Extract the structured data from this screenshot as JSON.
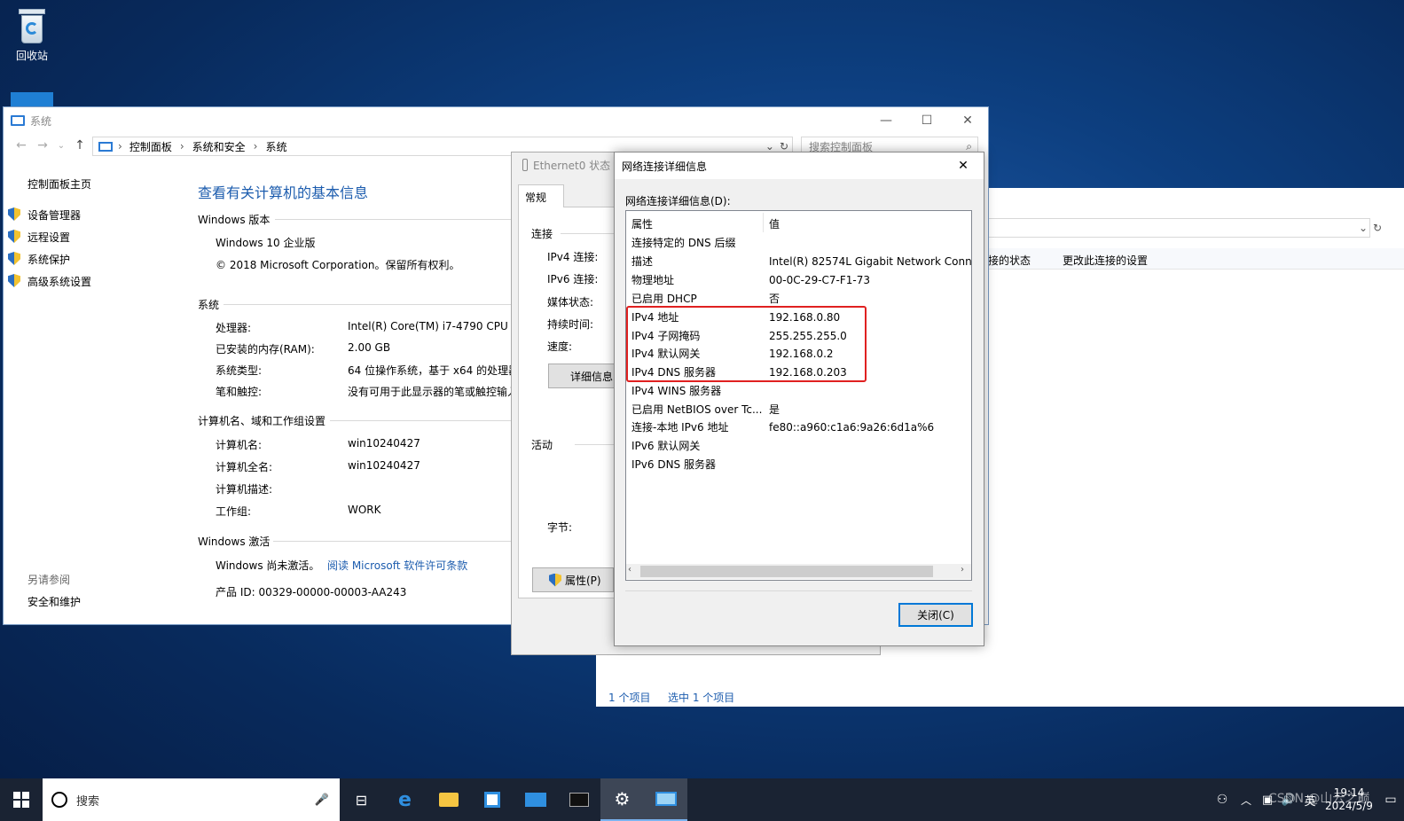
{
  "desktop": {
    "recycle_bin_label": "回收站"
  },
  "system_window": {
    "title": "系统",
    "breadcrumb": [
      "控制面板",
      "系统和安全",
      "系统"
    ],
    "search_placeholder": "搜索控制面板",
    "sidebar": {
      "home": "控制面板主页",
      "items": [
        "设备管理器",
        "远程设置",
        "系统保护",
        "高级系统设置"
      ],
      "see_also_title": "另请参阅",
      "see_also_items": [
        "安全和维护"
      ]
    },
    "heading": "查看有关计算机的基本信息",
    "windows_edition": {
      "title": "Windows 版本",
      "edition": "Windows 10 企业版",
      "copyright": "© 2018 Microsoft Corporation。保留所有权利。"
    },
    "system": {
      "title": "系统",
      "rows": [
        {
          "label": "处理器:",
          "value": "Intel(R) Core(TM) i7-4790 CPU @"
        },
        {
          "label": "已安装的内存(RAM):",
          "value": "2.00 GB"
        },
        {
          "label": "系统类型:",
          "value": "64 位操作系统，基于 x64 的处理器"
        },
        {
          "label": "笔和触控:",
          "value": "没有可用于此显示器的笔或触控输入"
        }
      ]
    },
    "computer_name": {
      "title": "计算机名、域和工作组设置",
      "rows": [
        {
          "label": "计算机名:",
          "value": "win10240427"
        },
        {
          "label": "计算机全名:",
          "value": "win10240427"
        },
        {
          "label": "计算机描述:",
          "value": ""
        },
        {
          "label": "工作组:",
          "value": "WORK"
        }
      ]
    },
    "activation": {
      "title": "Windows 激活",
      "status": "Windows 尚未激活。",
      "link": "阅读 Microsoft 软件许可条款",
      "product_id": "产品 ID: 00329-00000-00003-AA243"
    }
  },
  "ethernet_window": {
    "title": "Ethernet0 状态",
    "tab": "常规",
    "connection_title": "连接",
    "fields": [
      "IPv4 连接:",
      "IPv6 连接:",
      "媒体状态:",
      "持续时间:",
      "速度:"
    ],
    "details_button": "详细信息",
    "activity_title": "活动",
    "bytes_label": "字节:",
    "properties_button": "属性(P)"
  },
  "details_dialog": {
    "title": "网络连接详细信息",
    "list_label": "网络连接详细信息(D):",
    "col_property": "属性",
    "col_value": "值",
    "rows": [
      {
        "k": "连接特定的 DNS 后缀",
        "v": ""
      },
      {
        "k": "描述",
        "v": "Intel(R) 82574L Gigabit Network Connec"
      },
      {
        "k": "物理地址",
        "v": "00-0C-29-C7-F1-73"
      },
      {
        "k": "已启用 DHCP",
        "v": "否"
      },
      {
        "k": "IPv4 地址",
        "v": "192.168.0.80"
      },
      {
        "k": "IPv4 子网掩码",
        "v": "255.255.255.0"
      },
      {
        "k": "IPv4 默认网关",
        "v": "192.168.0.2"
      },
      {
        "k": "IPv4 DNS 服务器",
        "v": "192.168.0.203"
      },
      {
        "k": "IPv4 WINS 服务器",
        "v": ""
      },
      {
        "k": "已启用 NetBIOS over Tc...",
        "v": "是"
      },
      {
        "k": "连接-本地 IPv6 地址",
        "v": "fe80::a960:c1a6:9a26:6d1a%6"
      },
      {
        "k": "IPv6 默认网关",
        "v": ""
      },
      {
        "k": "IPv6 DNS 服务器",
        "v": ""
      }
    ],
    "close_button": "关闭(C)"
  },
  "explorer_window": {
    "toolbar_items": [
      "接的状态",
      "更改此连接的设置"
    ],
    "status_items": "1 个项目",
    "status_selected": "选中 1 个项目"
  },
  "taskbar": {
    "search_text": "搜索",
    "ime": "英",
    "time": "19:14",
    "date": "2024/5/9",
    "watermark": "CSDN @山云之巅"
  }
}
